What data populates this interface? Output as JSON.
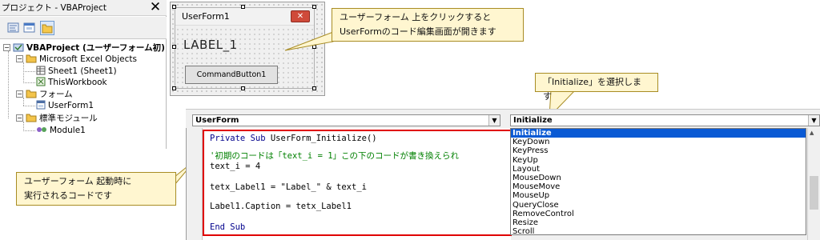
{
  "project_explorer": {
    "title": "プロジェクト - VBAProject",
    "close_glyph": "✕",
    "toolbar": [
      "view-code-icon",
      "view-object-icon",
      "toggle-folders-icon"
    ],
    "root": "VBAProject (ユーザーフォーム初)",
    "groups": [
      {
        "label": "Microsoft Excel Objects",
        "children": [
          "Sheet1 (Sheet1)",
          "ThisWorkbook"
        ]
      },
      {
        "label": "フォーム",
        "children": [
          "UserForm1"
        ]
      },
      {
        "label": "標準モジュール",
        "children": [
          "Module1"
        ]
      }
    ]
  },
  "userform": {
    "title": "UserForm1",
    "close_glyph": "✕",
    "label": "LABEL_1",
    "button": "CommandButton1"
  },
  "callouts": {
    "top": [
      "ユーザーフォーム 上をクリックすると",
      "UserFormのコード編集画面が開きます"
    ],
    "initialize": "「Initialize」を選択します",
    "left": [
      "ユーザーフォーム 起動時に",
      "実行されるコードです"
    ]
  },
  "code_window": {
    "object_combo": "UserForm",
    "proc_combo": "Initialize",
    "combo_arrow": "▼",
    "lines": [
      {
        "kw": "Private Sub ",
        "text": "UserForm_Initialize()"
      },
      {
        "comment": "'初期のコードは「text_i = 1」この下のコードが書き換えられ"
      },
      {
        "text": "text_i = 4"
      },
      {
        "text": "tetx_Label1 = \"Label_\" & text_i"
      },
      {
        "text": "Label1.Caption = tetx_Label1"
      },
      {
        "kw": "End Sub"
      }
    ],
    "events": [
      "Initialize",
      "KeyDown",
      "KeyPress",
      "KeyUp",
      "Layout",
      "MouseDown",
      "MouseMove",
      "MouseUp",
      "QueryClose",
      "RemoveControl",
      "Resize",
      "Scroll"
    ],
    "selected_event": "Initialize"
  },
  "colors": {
    "highlight_border": "#e00000",
    "keyword": "#00008c",
    "comment": "#008000",
    "selection": "#0a5ad4",
    "callout_bg": "#fff6d0"
  }
}
